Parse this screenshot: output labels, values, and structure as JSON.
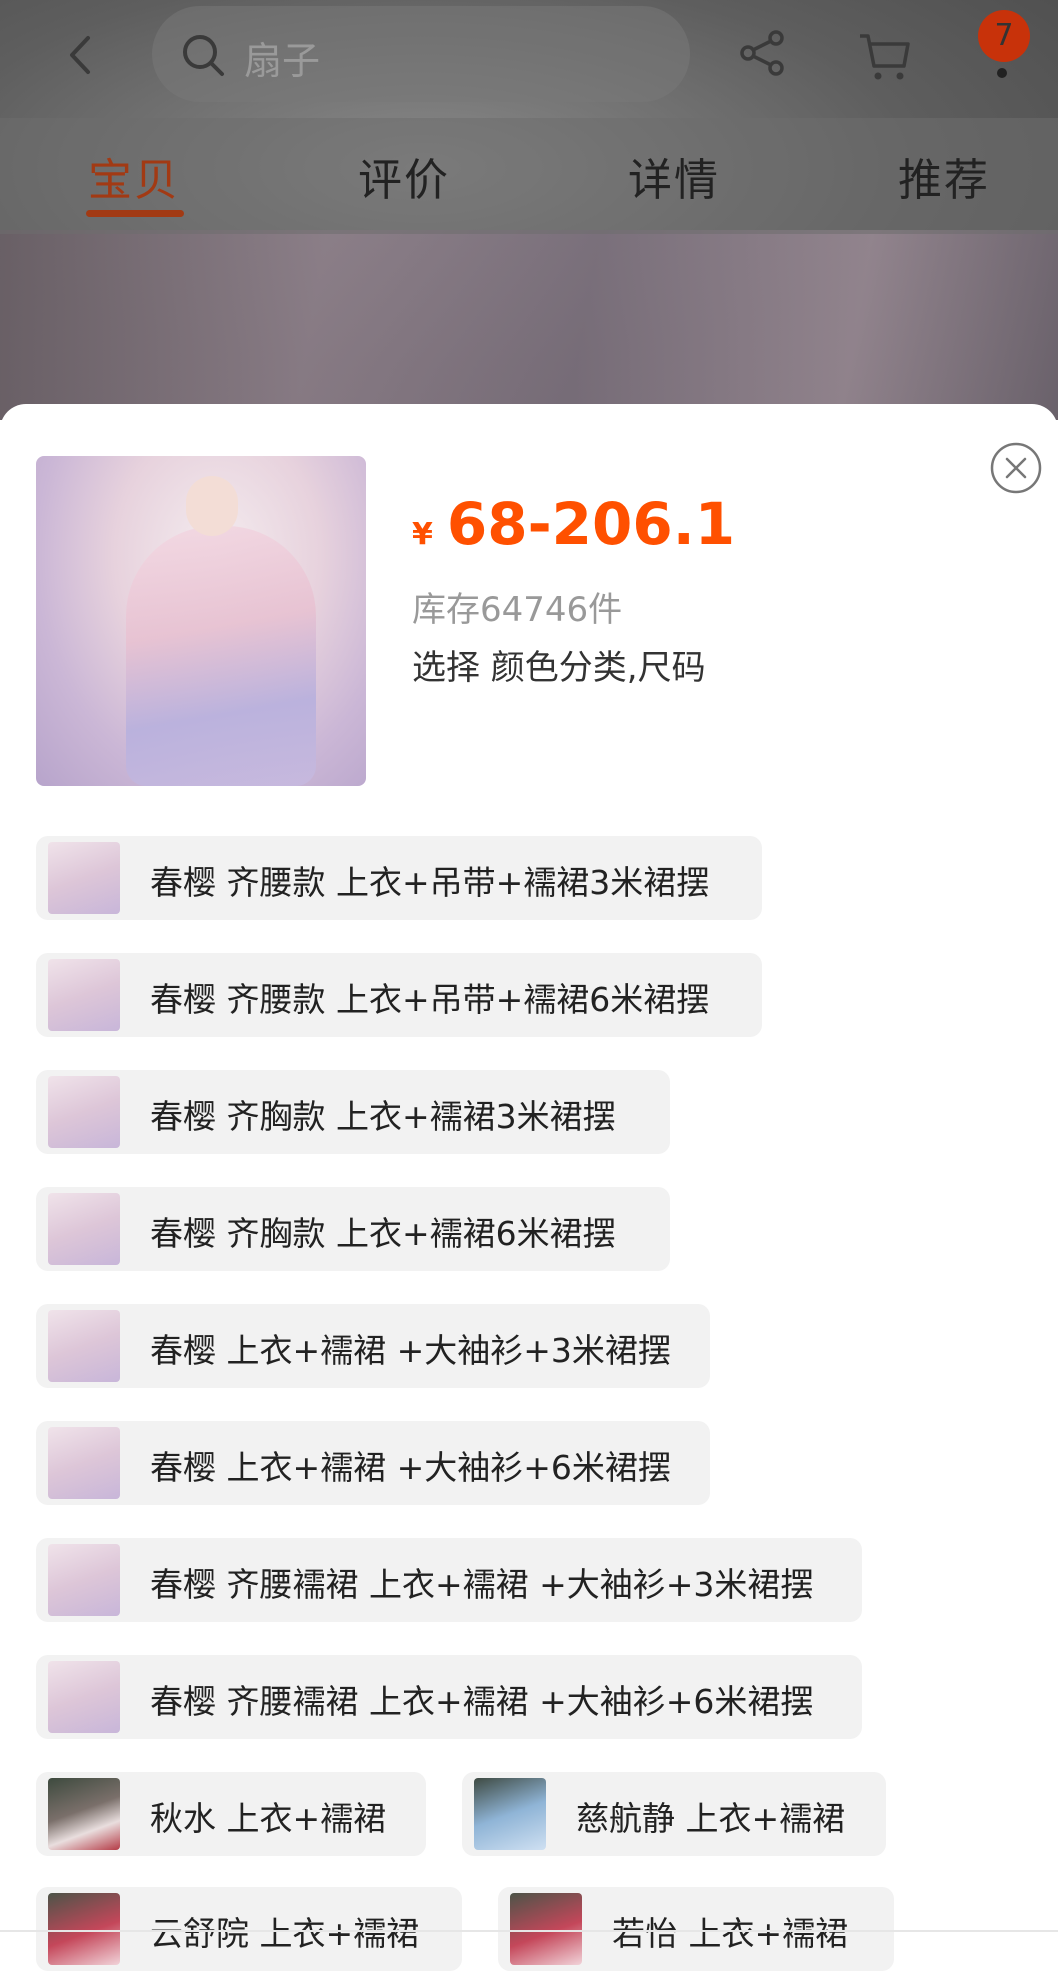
{
  "header": {
    "search_placeholder": "扇子",
    "cart_badge": "7"
  },
  "tabs": [
    {
      "label": "宝贝",
      "active": true
    },
    {
      "label": "评价",
      "active": false
    },
    {
      "label": "详情",
      "active": false
    },
    {
      "label": "推荐",
      "active": false
    }
  ],
  "sku": {
    "currency": "¥",
    "price": "68-206.1",
    "stock": "库存64746件",
    "select_prompt": "选择 颜色分类,尺码",
    "options": [
      "春樱 齐腰款 上衣+吊带+襦裙3米裙摆",
      "春樱 齐腰款 上衣+吊带+襦裙6米裙摆",
      "春樱 齐胸款 上衣+襦裙3米裙摆",
      "春樱 齐胸款 上衣+襦裙6米裙摆",
      "春樱 上衣+襦裙 +大袖衫+3米裙摆",
      "春樱 上衣+襦裙 +大袖衫+6米裙摆",
      "春樱 齐腰襦裙 上衣+襦裙 +大袖衫+3米裙摆",
      "春樱 齐腰襦裙 上衣+襦裙 +大袖衫+6米裙摆",
      "秋水 上衣+襦裙",
      "慈航静 上衣+襦裙",
      "云舒院 上衣+襦裙",
      "若怡 上衣+襦裙"
    ]
  },
  "colors": {
    "accent": "#ff5000",
    "active_tab": "#a23a14"
  }
}
